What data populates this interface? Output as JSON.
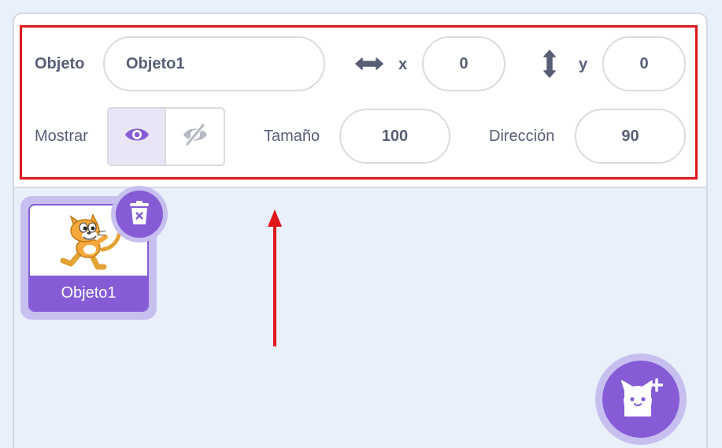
{
  "sprite_info": {
    "name_label": "Objeto",
    "name_value": "Objeto1",
    "x_label": "x",
    "x_value": "0",
    "y_label": "y",
    "y_value": "0",
    "show_label": "Mostrar",
    "size_label": "Tamaño",
    "size_value": "100",
    "direction_label": "Dirección",
    "direction_value": "90"
  },
  "sprite_list": {
    "items": [
      {
        "name": "Objeto1"
      }
    ]
  },
  "colors": {
    "accent": "#855cd6",
    "accent_light": "#c7bff0",
    "highlight": "#e0161c",
    "text": "#575e75"
  },
  "icons": [
    "x-arrows-icon",
    "y-arrows-icon",
    "eye-icon",
    "eye-off-icon",
    "trash-icon",
    "cat-sprite-thumbnail",
    "add-sprite-cat-icon",
    "annotation-arrow-icon"
  ]
}
